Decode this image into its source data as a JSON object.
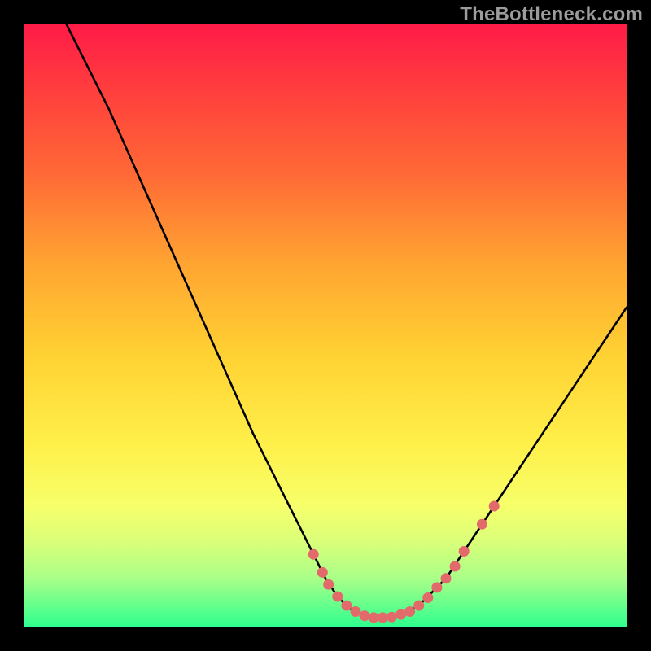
{
  "watermark": "TheBottleneck.com",
  "chart_data": {
    "type": "line",
    "title": "",
    "xlabel": "",
    "ylabel": "",
    "xlim": [
      0,
      100
    ],
    "ylim": [
      0,
      100
    ],
    "grid": false,
    "curve": [
      {
        "x": 7,
        "y": 100
      },
      {
        "x": 10,
        "y": 94
      },
      {
        "x": 14,
        "y": 86
      },
      {
        "x": 18,
        "y": 77
      },
      {
        "x": 22,
        "y": 68
      },
      {
        "x": 26,
        "y": 59
      },
      {
        "x": 30,
        "y": 50
      },
      {
        "x": 34,
        "y": 41
      },
      {
        "x": 38,
        "y": 32
      },
      {
        "x": 42,
        "y": 24
      },
      {
        "x": 46,
        "y": 16
      },
      {
        "x": 48,
        "y": 12
      },
      {
        "x": 50,
        "y": 8
      },
      {
        "x": 52,
        "y": 5
      },
      {
        "x": 54,
        "y": 3
      },
      {
        "x": 56,
        "y": 2
      },
      {
        "x": 58,
        "y": 1.5
      },
      {
        "x": 60,
        "y": 1.5
      },
      {
        "x": 62,
        "y": 1.7
      },
      {
        "x": 64,
        "y": 2.5
      },
      {
        "x": 66,
        "y": 4
      },
      {
        "x": 68,
        "y": 6
      },
      {
        "x": 70,
        "y": 8
      },
      {
        "x": 72,
        "y": 11
      },
      {
        "x": 74,
        "y": 14
      },
      {
        "x": 76,
        "y": 17
      },
      {
        "x": 78,
        "y": 20
      },
      {
        "x": 82,
        "y": 26
      },
      {
        "x": 86,
        "y": 32
      },
      {
        "x": 90,
        "y": 38
      },
      {
        "x": 94,
        "y": 44
      },
      {
        "x": 98,
        "y": 50
      },
      {
        "x": 100,
        "y": 53
      }
    ],
    "markers": [
      {
        "x": 48,
        "y": 12
      },
      {
        "x": 49.5,
        "y": 9
      },
      {
        "x": 50.5,
        "y": 7
      },
      {
        "x": 52,
        "y": 5
      },
      {
        "x": 53.5,
        "y": 3.5
      },
      {
        "x": 55,
        "y": 2.5
      },
      {
        "x": 56.5,
        "y": 1.8
      },
      {
        "x": 58,
        "y": 1.5
      },
      {
        "x": 59.5,
        "y": 1.5
      },
      {
        "x": 61,
        "y": 1.6
      },
      {
        "x": 62.5,
        "y": 2
      },
      {
        "x": 64,
        "y": 2.5
      },
      {
        "x": 65.5,
        "y": 3.5
      },
      {
        "x": 67,
        "y": 4.8
      },
      {
        "x": 68.5,
        "y": 6.5
      },
      {
        "x": 70,
        "y": 8
      },
      {
        "x": 71.5,
        "y": 10
      },
      {
        "x": 73,
        "y": 12.5
      },
      {
        "x": 76,
        "y": 17
      },
      {
        "x": 78,
        "y": 20
      }
    ],
    "marker_color": "#e26a6a",
    "line_color": "#000000"
  }
}
